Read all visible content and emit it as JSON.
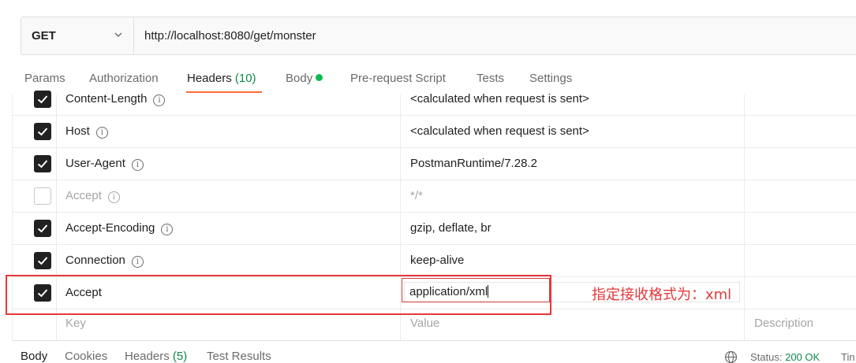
{
  "request": {
    "method": "GET",
    "url": "http://localhost:8080/get/monster"
  },
  "tabs": {
    "params": "Params",
    "authorization": "Authorization",
    "headers": "Headers",
    "headers_count": "(10)",
    "body": "Body",
    "prerequest": "Pre-request Script",
    "tests": "Tests",
    "settings": "Settings"
  },
  "headers": [
    {
      "key": "Content-Length",
      "value": "<calculated when request is sent>",
      "checked": true
    },
    {
      "key": "Host",
      "value": "<calculated when request is sent>",
      "checked": true
    },
    {
      "key": "User-Agent",
      "value": "PostmanRuntime/7.28.2",
      "checked": true
    },
    {
      "key": "Accept",
      "value": "*/*",
      "checked": false
    },
    {
      "key": "Accept-Encoding",
      "value": "gzip, deflate, br",
      "checked": true
    },
    {
      "key": "Connection",
      "value": "keep-alive",
      "checked": true
    },
    {
      "key": "Accept",
      "value": "application/xml",
      "checked": true
    }
  ],
  "new_row": {
    "key_placeholder": "Key",
    "value_placeholder": "Value",
    "description_placeholder": "Description"
  },
  "annotation": "指定接收格式为：xml",
  "response": {
    "body": "Body",
    "cookies": "Cookies",
    "headers": "Headers",
    "headers_count": "(5)",
    "test_results": "Test Results",
    "status_label": "Status:",
    "status_value": "200 OK",
    "time_label": "Tin"
  },
  "colors": {
    "accent": "#ff6c37",
    "success": "#0e8a4b",
    "highlight": "#e5383b"
  }
}
